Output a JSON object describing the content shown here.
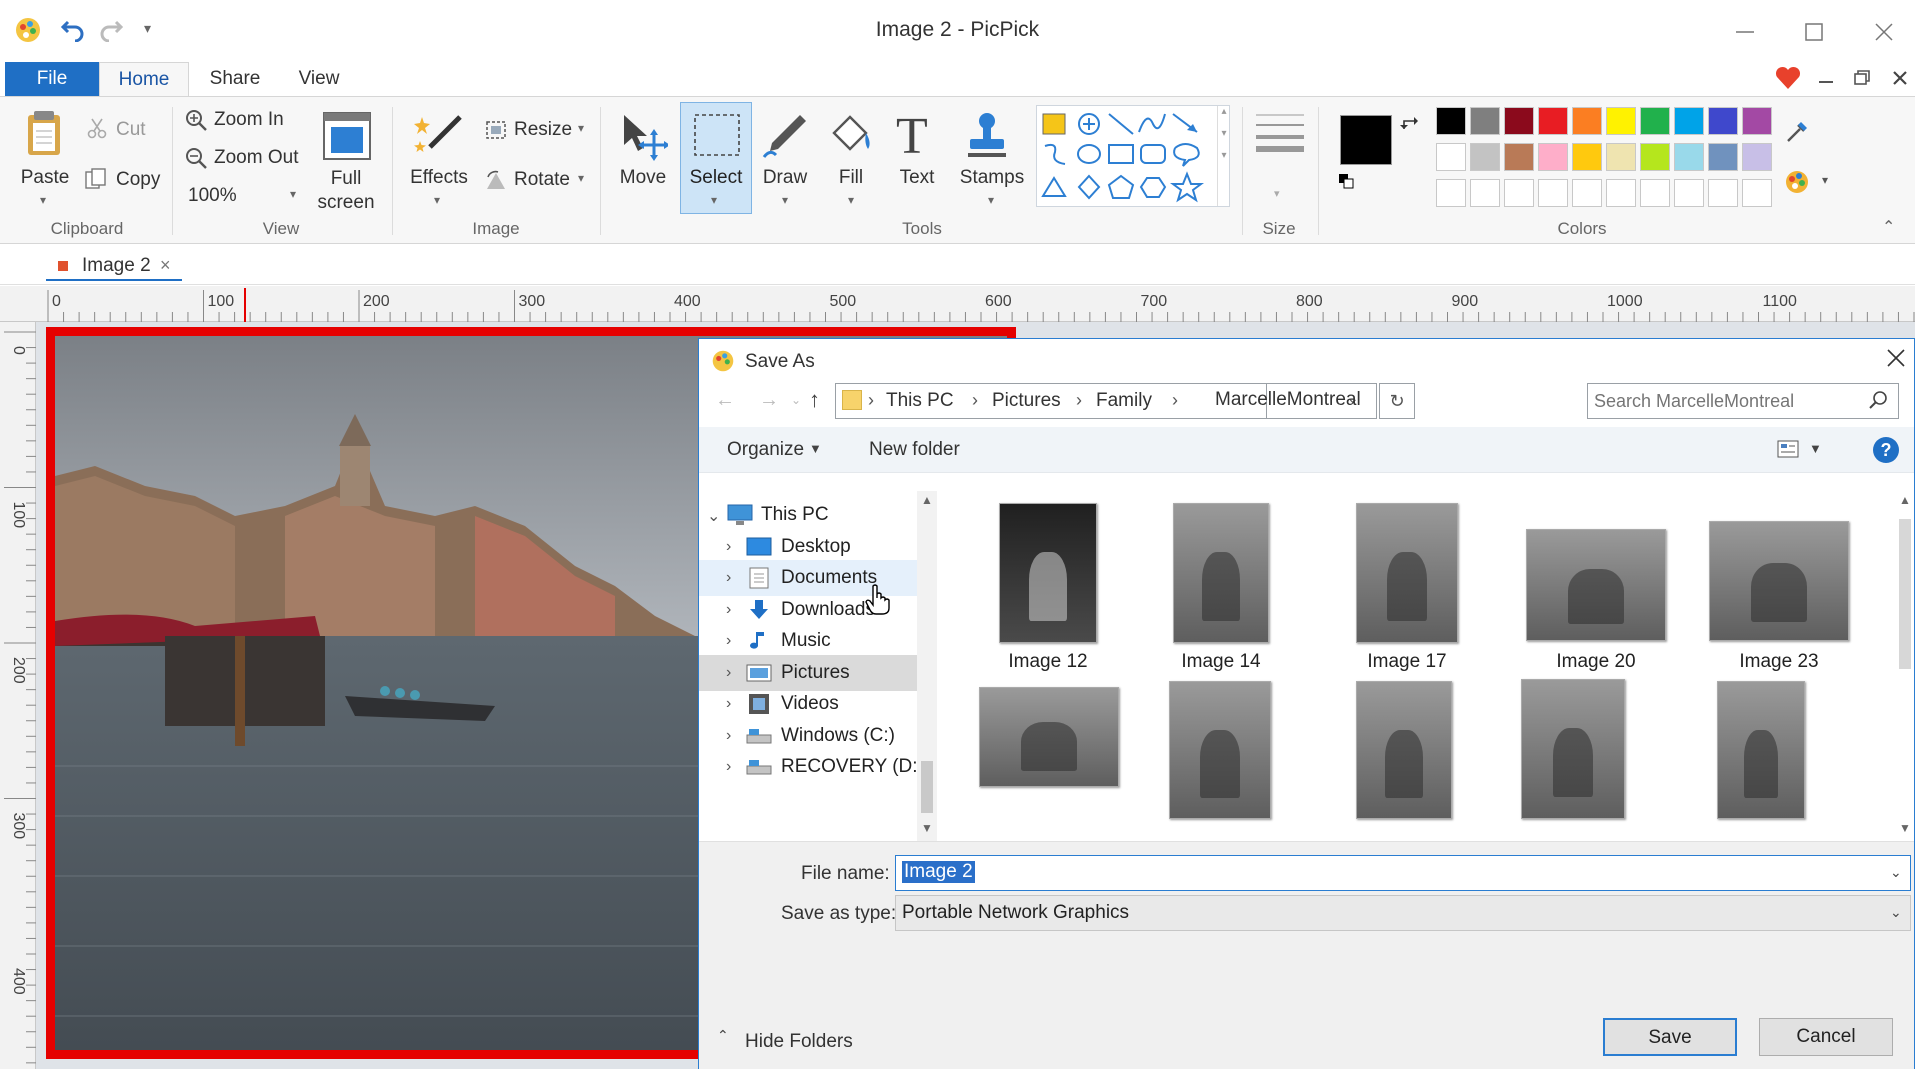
{
  "window": {
    "title": "Image 2 - PicPick"
  },
  "menu": {
    "tabs": [
      "File",
      "Home",
      "Share",
      "View"
    ]
  },
  "ribbon": {
    "clipboard": {
      "paste": "Paste",
      "cut": "Cut",
      "copy": "Copy",
      "label": "Clipboard"
    },
    "view": {
      "zoom_in": "Zoom In",
      "zoom_out": "Zoom Out",
      "zoom_level": "100%",
      "full_screen_1": "Full",
      "full_screen_2": "screen",
      "label": "View"
    },
    "image": {
      "effects": "Effects",
      "resize": "Resize",
      "rotate": "Rotate",
      "label": "Image"
    },
    "tools": {
      "move": "Move",
      "select": "Select",
      "draw": "Draw",
      "fill": "Fill",
      "text": "Text",
      "stamps": "Stamps",
      "label": "Tools"
    },
    "size": {
      "label": "Size"
    },
    "colors": {
      "label": "Colors",
      "primary": "#000000",
      "secondary": "#ffffff",
      "palette_row1": [
        "#000000",
        "#7f7f7f",
        "#8b0a1c",
        "#e81d23",
        "#fb7e22",
        "#fff200",
        "#21b14c",
        "#00a3e8",
        "#3f48cc",
        "#a349a4"
      ],
      "palette_row2": [
        "#ffffff",
        "#c3c3c3",
        "#b97a57",
        "#feaec9",
        "#ffc90e",
        "#efe4b0",
        "#b5e61d",
        "#99d9ea",
        "#7092be",
        "#c8bfe7"
      ]
    }
  },
  "doc_tab": {
    "name": "Image 2"
  },
  "ruler": {
    "h_marks": [
      "0",
      "100",
      "200",
      "300",
      "400",
      "500",
      "600",
      "700",
      "800",
      "900",
      "1000",
      "1100"
    ],
    "v_marks": [
      "0",
      "100",
      "200",
      "300",
      "400"
    ]
  },
  "dialog": {
    "title": "Save As",
    "breadcrumb": [
      "This PC",
      "Pictures",
      "Family",
      "MarcelleMontreal"
    ],
    "search_placeholder": "Search MarcelleMontreal",
    "organize": "Organize",
    "new_folder": "New folder",
    "nav": [
      {
        "label": "This PC",
        "icon": "monitor-icon"
      },
      {
        "label": "Desktop",
        "icon": "desktop-icon"
      },
      {
        "label": "Documents",
        "icon": "documents-icon"
      },
      {
        "label": "Downloads",
        "icon": "download-icon"
      },
      {
        "label": "Music",
        "icon": "music-icon"
      },
      {
        "label": "Pictures",
        "icon": "pictures-icon"
      },
      {
        "label": "Videos",
        "icon": "videos-icon"
      },
      {
        "label": "Windows (C:)",
        "icon": "drive-icon"
      },
      {
        "label": "RECOVERY (D:)",
        "icon": "drive-icon"
      }
    ],
    "files_row1": [
      "Image 12",
      "Image 14",
      "Image 17",
      "Image 20",
      "Image 23"
    ],
    "file_name_label": "File name:",
    "file_name_value": "Image 2",
    "save_type_label": "Save as type:",
    "save_type_value": "Portable Network Graphics",
    "hide_folders": "Hide Folders",
    "save_button": "Save",
    "cancel_button": "Cancel"
  }
}
